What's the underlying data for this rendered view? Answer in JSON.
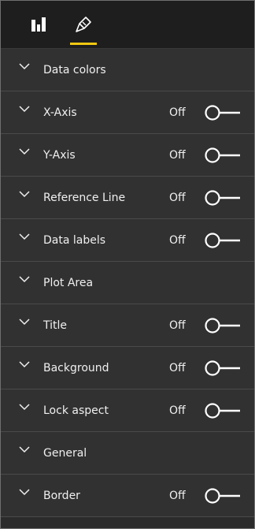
{
  "colors": {
    "panel_bg": "#313131",
    "tabbar_bg": "#1e1e1e",
    "text": "#f0f0f0",
    "accent": "#f2c811"
  },
  "tabs": [
    {
      "name": "fields",
      "icon": "bar-chart-icon",
      "active": false
    },
    {
      "name": "format",
      "icon": "paint-roller-icon",
      "active": true
    }
  ],
  "sections": [
    {
      "label": "Data colors",
      "has_toggle": false
    },
    {
      "label": "X-Axis",
      "has_toggle": true,
      "status": "Off"
    },
    {
      "label": "Y-Axis",
      "has_toggle": true,
      "status": "Off"
    },
    {
      "label": "Reference Line",
      "has_toggle": true,
      "status": "Off"
    },
    {
      "label": "Data labels",
      "has_toggle": true,
      "status": "Off"
    },
    {
      "label": "Plot Area",
      "has_toggle": false
    },
    {
      "label": "Title",
      "has_toggle": true,
      "status": "Off"
    },
    {
      "label": "Background",
      "has_toggle": true,
      "status": "Off"
    },
    {
      "label": "Lock aspect",
      "has_toggle": true,
      "status": "Off"
    },
    {
      "label": "General",
      "has_toggle": false
    },
    {
      "label": "Border",
      "has_toggle": true,
      "status": "Off"
    }
  ]
}
